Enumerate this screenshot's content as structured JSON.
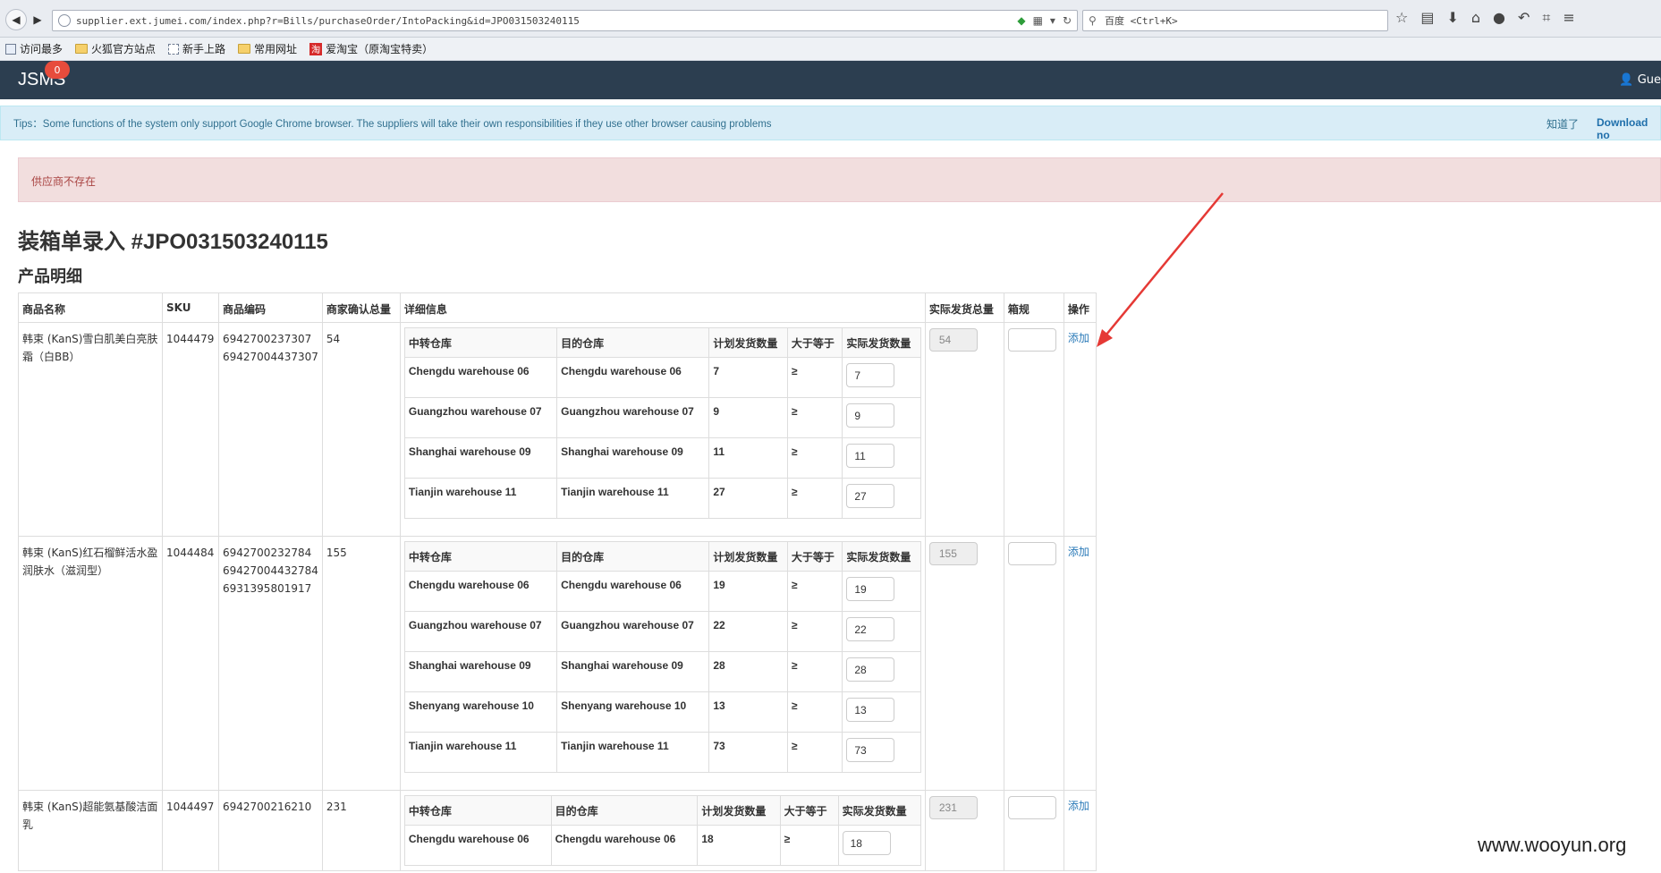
{
  "browser": {
    "url": "supplier.ext.jumei.com/index.php?r=Bills/purchaseOrder/IntoPacking&id=JPO031503240115",
    "search_placeholder": "百度 <Ctrl+K>",
    "bookmarks": [
      "访问最多",
      "火狐官方站点",
      "新手上路",
      "常用网址",
      "爱淘宝（原淘宝特卖）"
    ]
  },
  "app": {
    "brand": "JSMS",
    "badge_count": "0",
    "user": "Gue"
  },
  "tips": {
    "text": "Tips：Some functions of the system only support Google Chrome browser. The suppliers will take their own responsibilities if they use other browser causing problems",
    "dismiss": "知道了",
    "download": "Download no"
  },
  "alert": {
    "text": "供应商不存在"
  },
  "page": {
    "title": "装箱单录入 #JPO031503240115",
    "section": "产品明细"
  },
  "table": {
    "headers": [
      "商品名称",
      "SKU",
      "商品编码",
      "商家确认总量",
      "详细信息",
      "实际发货总量",
      "箱规",
      "操作"
    ],
    "sub_headers": [
      "中转仓库",
      "目的仓库",
      "计划发货数量",
      "大于等于",
      "实际发货数量"
    ],
    "ge_symbol": "≥",
    "action_label": "添加",
    "rows": [
      {
        "name": "韩束 (KanS)雪白肌美白亮肤霜（白BB）",
        "sku": "1044479",
        "codes": "6942700237307 69427004437307",
        "confirmed": "54",
        "total": "54",
        "details": [
          {
            "from": "Chengdu warehouse 06",
            "to": "Chengdu warehouse 06",
            "planned": "7",
            "actual": "7"
          },
          {
            "from": "Guangzhou warehouse 07",
            "to": "Guangzhou warehouse 07",
            "planned": "9",
            "actual": "9"
          },
          {
            "from": "Shanghai warehouse 09",
            "to": "Shanghai warehouse 09",
            "planned": "11",
            "actual": "11"
          },
          {
            "from": "Tianjin warehouse 11",
            "to": "Tianjin warehouse 11",
            "planned": "27",
            "actual": "27"
          }
        ]
      },
      {
        "name": "韩束 (KanS)红石榴鲜活水盈润肤水（滋润型）",
        "sku": "1044484",
        "codes": "6942700232784 69427004432784 6931395801917",
        "confirmed": "155",
        "total": "155",
        "details": [
          {
            "from": "Chengdu warehouse 06",
            "to": "Chengdu warehouse 06",
            "planned": "19",
            "actual": "19"
          },
          {
            "from": "Guangzhou warehouse 07",
            "to": "Guangzhou warehouse 07",
            "planned": "22",
            "actual": "22"
          },
          {
            "from": "Shanghai warehouse 09",
            "to": "Shanghai warehouse 09",
            "planned": "28",
            "actual": "28"
          },
          {
            "from": "Shenyang warehouse 10",
            "to": "Shenyang warehouse 10",
            "planned": "13",
            "actual": "13"
          },
          {
            "from": "Tianjin warehouse 11",
            "to": "Tianjin warehouse 11",
            "planned": "73",
            "actual": "73"
          }
        ]
      },
      {
        "name": "韩束 (KanS)超能氨基酸洁面乳",
        "sku": "1044497",
        "codes": "6942700216210",
        "confirmed": "231",
        "total": "231",
        "details": [
          {
            "from": "Chengdu warehouse 06",
            "to": "Chengdu warehouse 06",
            "planned": "18",
            "actual": "18"
          }
        ]
      }
    ]
  },
  "watermark": "www.wooyun.org",
  "colors": {
    "appbar": "#2c3e50",
    "badge": "#e74c3c",
    "arrow": "#e53935",
    "link": "#2a7ab8"
  }
}
